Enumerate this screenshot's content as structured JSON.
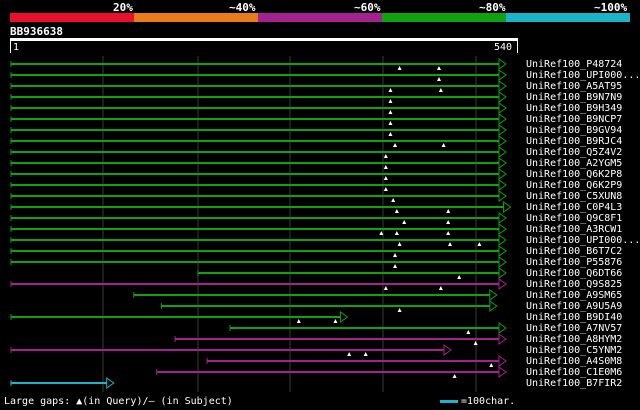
{
  "legend": {
    "labels": [
      "20%",
      "~40%",
      "~60%",
      "~80%",
      "~100%"
    ],
    "colors": [
      "#e8102c",
      "#e87b1c",
      "#a2228f",
      "#10a010",
      "#1bb3c8"
    ]
  },
  "query": {
    "name": "BB936638",
    "start_label": "1",
    "end_label": "540",
    "length": 540
  },
  "hits": [
    {
      "name": "UniRef100_P48724",
      "color": "green",
      "start": 1,
      "end": 540,
      "gaps": [
        425,
        468
      ]
    },
    {
      "name": "UniRef100_UPI000...",
      "color": "green",
      "start": 1,
      "end": 540,
      "gaps": [
        468
      ]
    },
    {
      "name": "UniRef100_A5AT95",
      "color": "green",
      "start": 1,
      "end": 540,
      "gaps": [
        415,
        470
      ]
    },
    {
      "name": "UniRef100_B9N7N9",
      "color": "green",
      "start": 1,
      "end": 540,
      "gaps": [
        415
      ]
    },
    {
      "name": "UniRef100_B9H349",
      "color": "green",
      "start": 1,
      "end": 540,
      "gaps": [
        415
      ]
    },
    {
      "name": "UniRef100_B9NCP7",
      "color": "green",
      "start": 1,
      "end": 540,
      "gaps": [
        415
      ]
    },
    {
      "name": "UniRef100_B9GV94",
      "color": "green",
      "start": 1,
      "end": 540,
      "gaps": [
        415
      ]
    },
    {
      "name": "UniRef100_B9RJC4",
      "color": "green",
      "start": 1,
      "end": 540,
      "gaps": [
        420,
        473
      ]
    },
    {
      "name": "UniRef100_Q5Z4V2",
      "color": "green",
      "start": 1,
      "end": 540,
      "gaps": [
        410
      ]
    },
    {
      "name": "UniRef100_A2YGM5",
      "color": "green",
      "start": 1,
      "end": 540,
      "gaps": [
        410
      ]
    },
    {
      "name": "UniRef100_Q6K2P8",
      "color": "green",
      "start": 1,
      "end": 540,
      "gaps": [
        410
      ]
    },
    {
      "name": "UniRef100_Q6K2P9",
      "color": "green",
      "start": 1,
      "end": 540,
      "gaps": [
        410
      ]
    },
    {
      "name": "UniRef100_C5XUN8",
      "color": "green",
      "start": 1,
      "end": 540,
      "gaps": [
        418
      ]
    },
    {
      "name": "UniRef100_C0P4L3",
      "color": "green",
      "start": 1,
      "end": 545,
      "gaps": [
        422,
        478
      ]
    },
    {
      "name": "UniRef100_Q9C8F1",
      "color": "green",
      "start": 1,
      "end": 540,
      "gaps": [
        430,
        478
      ]
    },
    {
      "name": "UniRef100_A3RCW1",
      "color": "green",
      "start": 1,
      "end": 540,
      "gaps": [
        405,
        422,
        478
      ]
    },
    {
      "name": "UniRef100_UPI000...",
      "color": "green",
      "start": 1,
      "end": 540,
      "gaps": [
        425,
        480,
        512
      ]
    },
    {
      "name": "UniRef100_B6T7C2",
      "color": "green",
      "start": 1,
      "end": 540,
      "gaps": [
        420
      ]
    },
    {
      "name": "UniRef100_P55876",
      "color": "green",
      "start": 1,
      "end": 540,
      "gaps": [
        420
      ]
    },
    {
      "name": "UniRef100_Q6DT66",
      "color": "green",
      "start": 205,
      "end": 540,
      "gaps": [
        490
      ]
    },
    {
      "name": "UniRef100_Q9S825",
      "color": "purple",
      "start": 1,
      "end": 540,
      "gaps": [
        410,
        470
      ]
    },
    {
      "name": "UniRef100_A9SM65",
      "color": "green",
      "start": 135,
      "end": 530,
      "gaps": []
    },
    {
      "name": "UniRef100_A9U5A9",
      "color": "green",
      "start": 165,
      "end": 530,
      "gaps": [
        425
      ]
    },
    {
      "name": "UniRef100_B9DI40",
      "color": "green",
      "start": 1,
      "end": 367,
      "gaps": [
        315,
        355
      ]
    },
    {
      "name": "UniRef100_A7NV57",
      "color": "green",
      "start": 240,
      "end": 540,
      "gaps": [
        500
      ]
    },
    {
      "name": "UniRef100_A8HYM2",
      "color": "purple",
      "start": 180,
      "end": 540,
      "gaps": [
        508
      ]
    },
    {
      "name": "UniRef100_C5YNM2",
      "color": "purple",
      "start": 1,
      "end": 480,
      "gaps": [
        370,
        388
      ]
    },
    {
      "name": "UniRef100_A4S0M8",
      "color": "purple",
      "start": 215,
      "end": 540,
      "gaps": [
        525
      ]
    },
    {
      "name": "UniRef100_C1E0M6",
      "color": "purple",
      "start": 160,
      "end": 540,
      "gaps": [
        485
      ]
    },
    {
      "name": "UniRef100_B7FIR2",
      "color": "cyan",
      "start": 1,
      "end": 112,
      "gaps": []
    }
  ],
  "footer": {
    "text": "Large gaps: ▲(in Query)/– (in Subject)",
    "scale_text": "=100char."
  }
}
